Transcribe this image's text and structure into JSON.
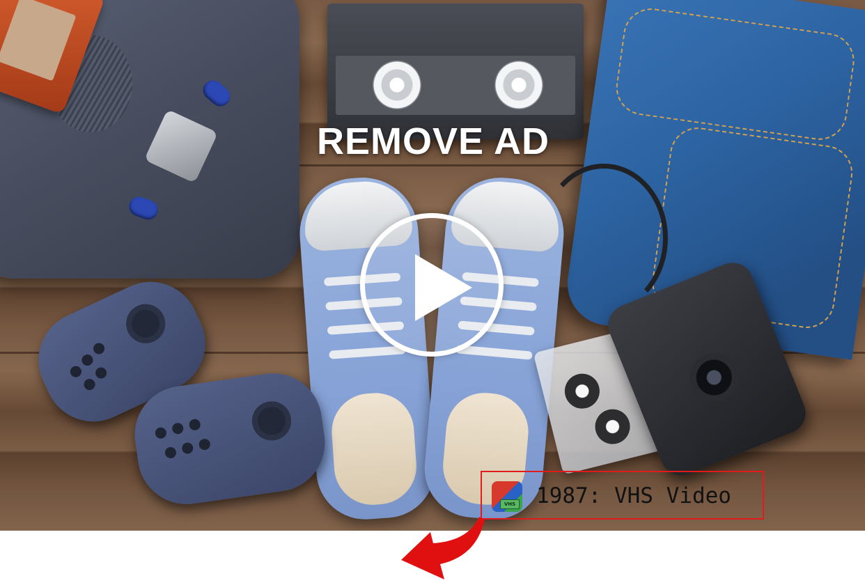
{
  "ad": {
    "remove_ad_label": "REMOVE AD",
    "play_icon": "play-icon"
  },
  "app": {
    "title": "1987: VHS Video",
    "icon_name": "vhs-app-icon",
    "icon_tag": "VHS"
  },
  "colors": {
    "highlight_border": "#e01b1b",
    "arrow": "#e01010",
    "overlay_text": "#ffffff"
  }
}
